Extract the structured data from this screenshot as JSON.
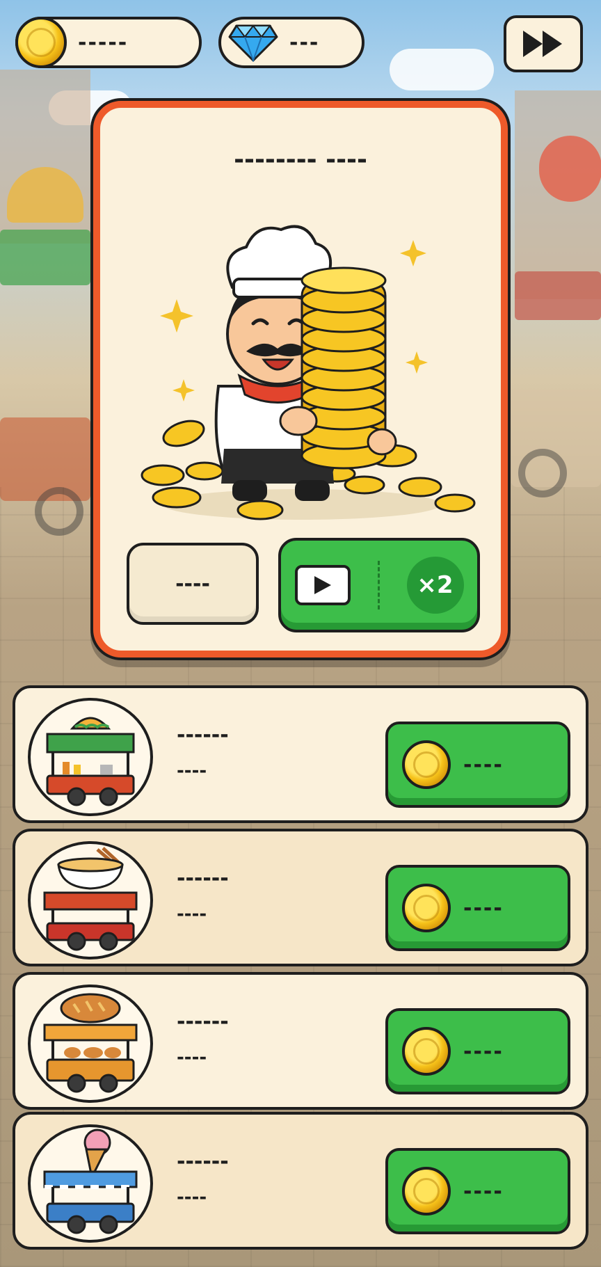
{
  "hud": {
    "coin_balance": "-----",
    "gem_balance": "---",
    "coin_icon": "gold-coin-icon",
    "gem_icon": "blue-diamond-icon",
    "fast_forward_icon": "fast-forward-icon"
  },
  "reward_panel": {
    "title": "-------- ----",
    "illustration": "chef-holding-coin-stack",
    "skip_label": "----",
    "double_label": "×2",
    "double_icon": "play-video-icon"
  },
  "carts": [
    {
      "name": "------",
      "rate": "----",
      "price": "----",
      "icon": "taco-cart-icon"
    },
    {
      "name": "------",
      "rate": "----",
      "price": "----",
      "icon": "noodle-cart-icon"
    },
    {
      "name": "------",
      "rate": "----",
      "price": "----",
      "icon": "bakery-cart-icon"
    },
    {
      "name": "------",
      "rate": "----",
      "price": "----",
      "icon": "ice-cream-cart-icon"
    }
  ],
  "colors": {
    "panel_border": "#ee5a2a",
    "button_green": "#3dbe4a",
    "cream": "#fbf1dc",
    "outline": "#1e1e1e"
  }
}
